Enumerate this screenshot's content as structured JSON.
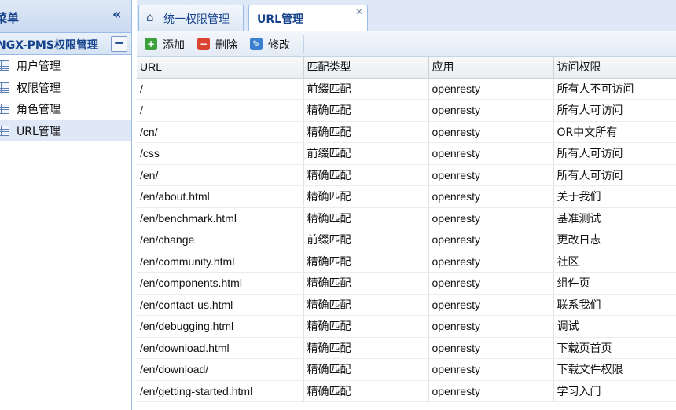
{
  "sidebar": {
    "title": "菜单",
    "group_title": "NGX-PMS权限管理",
    "items": [
      {
        "label": "用户管理",
        "selected": false
      },
      {
        "label": "权限管理",
        "selected": false
      },
      {
        "label": "角色管理",
        "selected": false
      },
      {
        "label": "URL管理",
        "selected": true
      }
    ]
  },
  "tabs": [
    {
      "label": "统一权限管理",
      "active": false,
      "icon": "home-icon"
    },
    {
      "label": "URL管理",
      "active": true,
      "icon": "close-icon"
    }
  ],
  "toolbar": {
    "add_label": "添加",
    "delete_label": "删除",
    "edit_label": "修改"
  },
  "grid": {
    "columns": [
      "URL",
      "匹配类型",
      "应用",
      "访问权限"
    ],
    "rows": [
      [
        "/",
        "前缀匹配",
        "openresty",
        "所有人不可访问"
      ],
      [
        "/",
        "精确匹配",
        "openresty",
        "所有人可访问"
      ],
      [
        "/cn/",
        "精确匹配",
        "openresty",
        "OR中文所有"
      ],
      [
        "/css",
        "前缀匹配",
        "openresty",
        "所有人可访问"
      ],
      [
        "/en/",
        "精确匹配",
        "openresty",
        "所有人可访问"
      ],
      [
        "/en/about.html",
        "精确匹配",
        "openresty",
        "关于我们"
      ],
      [
        "/en/benchmark.html",
        "精确匹配",
        "openresty",
        "基准测试"
      ],
      [
        "/en/change",
        "前缀匹配",
        "openresty",
        "更改日志"
      ],
      [
        "/en/community.html",
        "精确匹配",
        "openresty",
        "社区"
      ],
      [
        "/en/components.html",
        "精确匹配",
        "openresty",
        "组件页"
      ],
      [
        "/en/contact-us.html",
        "精确匹配",
        "openresty",
        "联系我们"
      ],
      [
        "/en/debugging.html",
        "精确匹配",
        "openresty",
        "调试"
      ],
      [
        "/en/download.html",
        "精确匹配",
        "openresty",
        "下载页首页"
      ],
      [
        "/en/download/",
        "精确匹配",
        "openresty",
        "下载文件权限"
      ],
      [
        "/en/getting-started.html",
        "精确匹配",
        "openresty",
        "学习入门"
      ]
    ]
  },
  "colors": {
    "panel_border": "#99bbe8",
    "header_text": "#15428b",
    "selected_row": "#dfe8f6"
  }
}
